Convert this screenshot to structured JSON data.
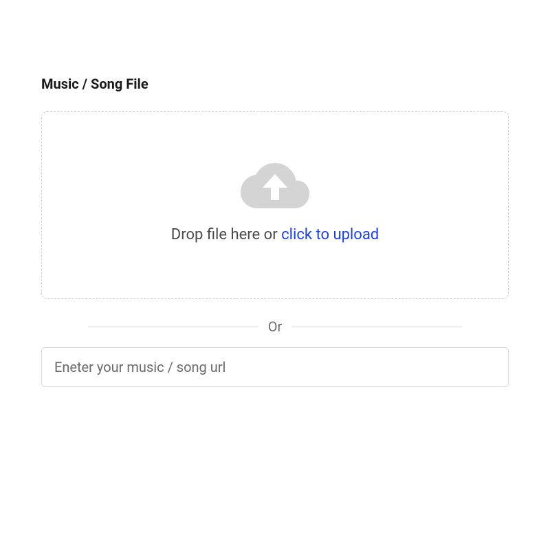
{
  "section": {
    "title": "Music / Song File"
  },
  "dropzone": {
    "prefix_text": "Drop file here or ",
    "link_text": "click to upload",
    "icon_name": "cloud-upload-icon"
  },
  "divider": {
    "label": "Or"
  },
  "url_field": {
    "value": "",
    "placeholder": "Eneter your music / song url"
  }
}
